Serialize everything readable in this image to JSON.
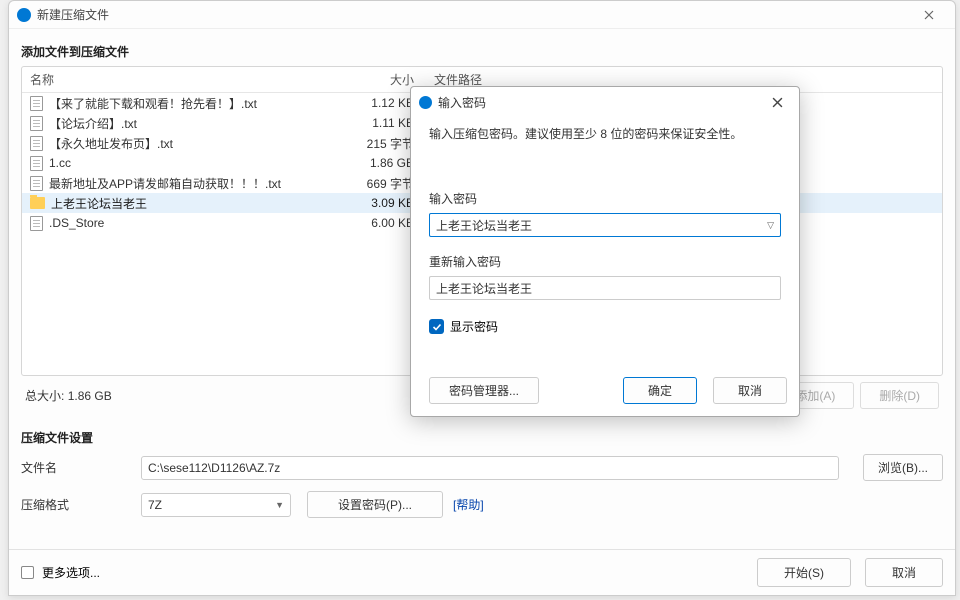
{
  "window": {
    "title": "新建压缩文件"
  },
  "section": {
    "add_files_label": "添加文件到压缩文件"
  },
  "columns": {
    "name": "名称",
    "size": "大小",
    "path": "文件路径"
  },
  "files": [
    {
      "name": "【来了就能下载和观看！抢先看！】.txt",
      "size": "1.12 KB",
      "icon": "doc"
    },
    {
      "name": "【论坛介绍】.txt",
      "size": "1.11 KB",
      "icon": "doc"
    },
    {
      "name": "【永久地址发布页】.txt",
      "size": "215 字节",
      "icon": "doc"
    },
    {
      "name": "1.cc",
      "size": "1.86 GB",
      "icon": "doc"
    },
    {
      "name": "最新地址及APP请发邮箱自动获取！！！.txt",
      "size": "669 字节",
      "icon": "doc"
    },
    {
      "name": "上老王论坛当老王",
      "size": "3.09 KB",
      "icon": "folder",
      "selected": true
    },
    {
      "name": ".DS_Store",
      "size": "6.00 KB",
      "icon": "doc"
    }
  ],
  "total": {
    "label": "总大小:",
    "value": "1.86 GB"
  },
  "buttons": {
    "add": "添加(A)",
    "delete": "删除(D)",
    "browse": "浏览(B)...",
    "set_password": "设置密码(P)...",
    "help": "[帮助]",
    "start": "开始(S)",
    "cancel": "取消",
    "more_options": "更多选项..."
  },
  "settings": {
    "section_label": "压缩文件设置",
    "filename_label": "文件名",
    "filename_value": "C:\\sese112\\D1126\\AZ.7z",
    "format_label": "压缩格式",
    "format_value": "7Z"
  },
  "modal": {
    "title": "输入密码",
    "hint": "输入压缩包密码。建议使用至少 8 位的密码来保证安全性。",
    "password_label": "输入密码",
    "password_value": "上老王论坛当老王",
    "repeat_label": "重新输入密码",
    "repeat_value": "上老王论坛当老王",
    "show_password": "显示密码",
    "manager": "密码管理器...",
    "ok": "确定",
    "cancel": "取消"
  }
}
